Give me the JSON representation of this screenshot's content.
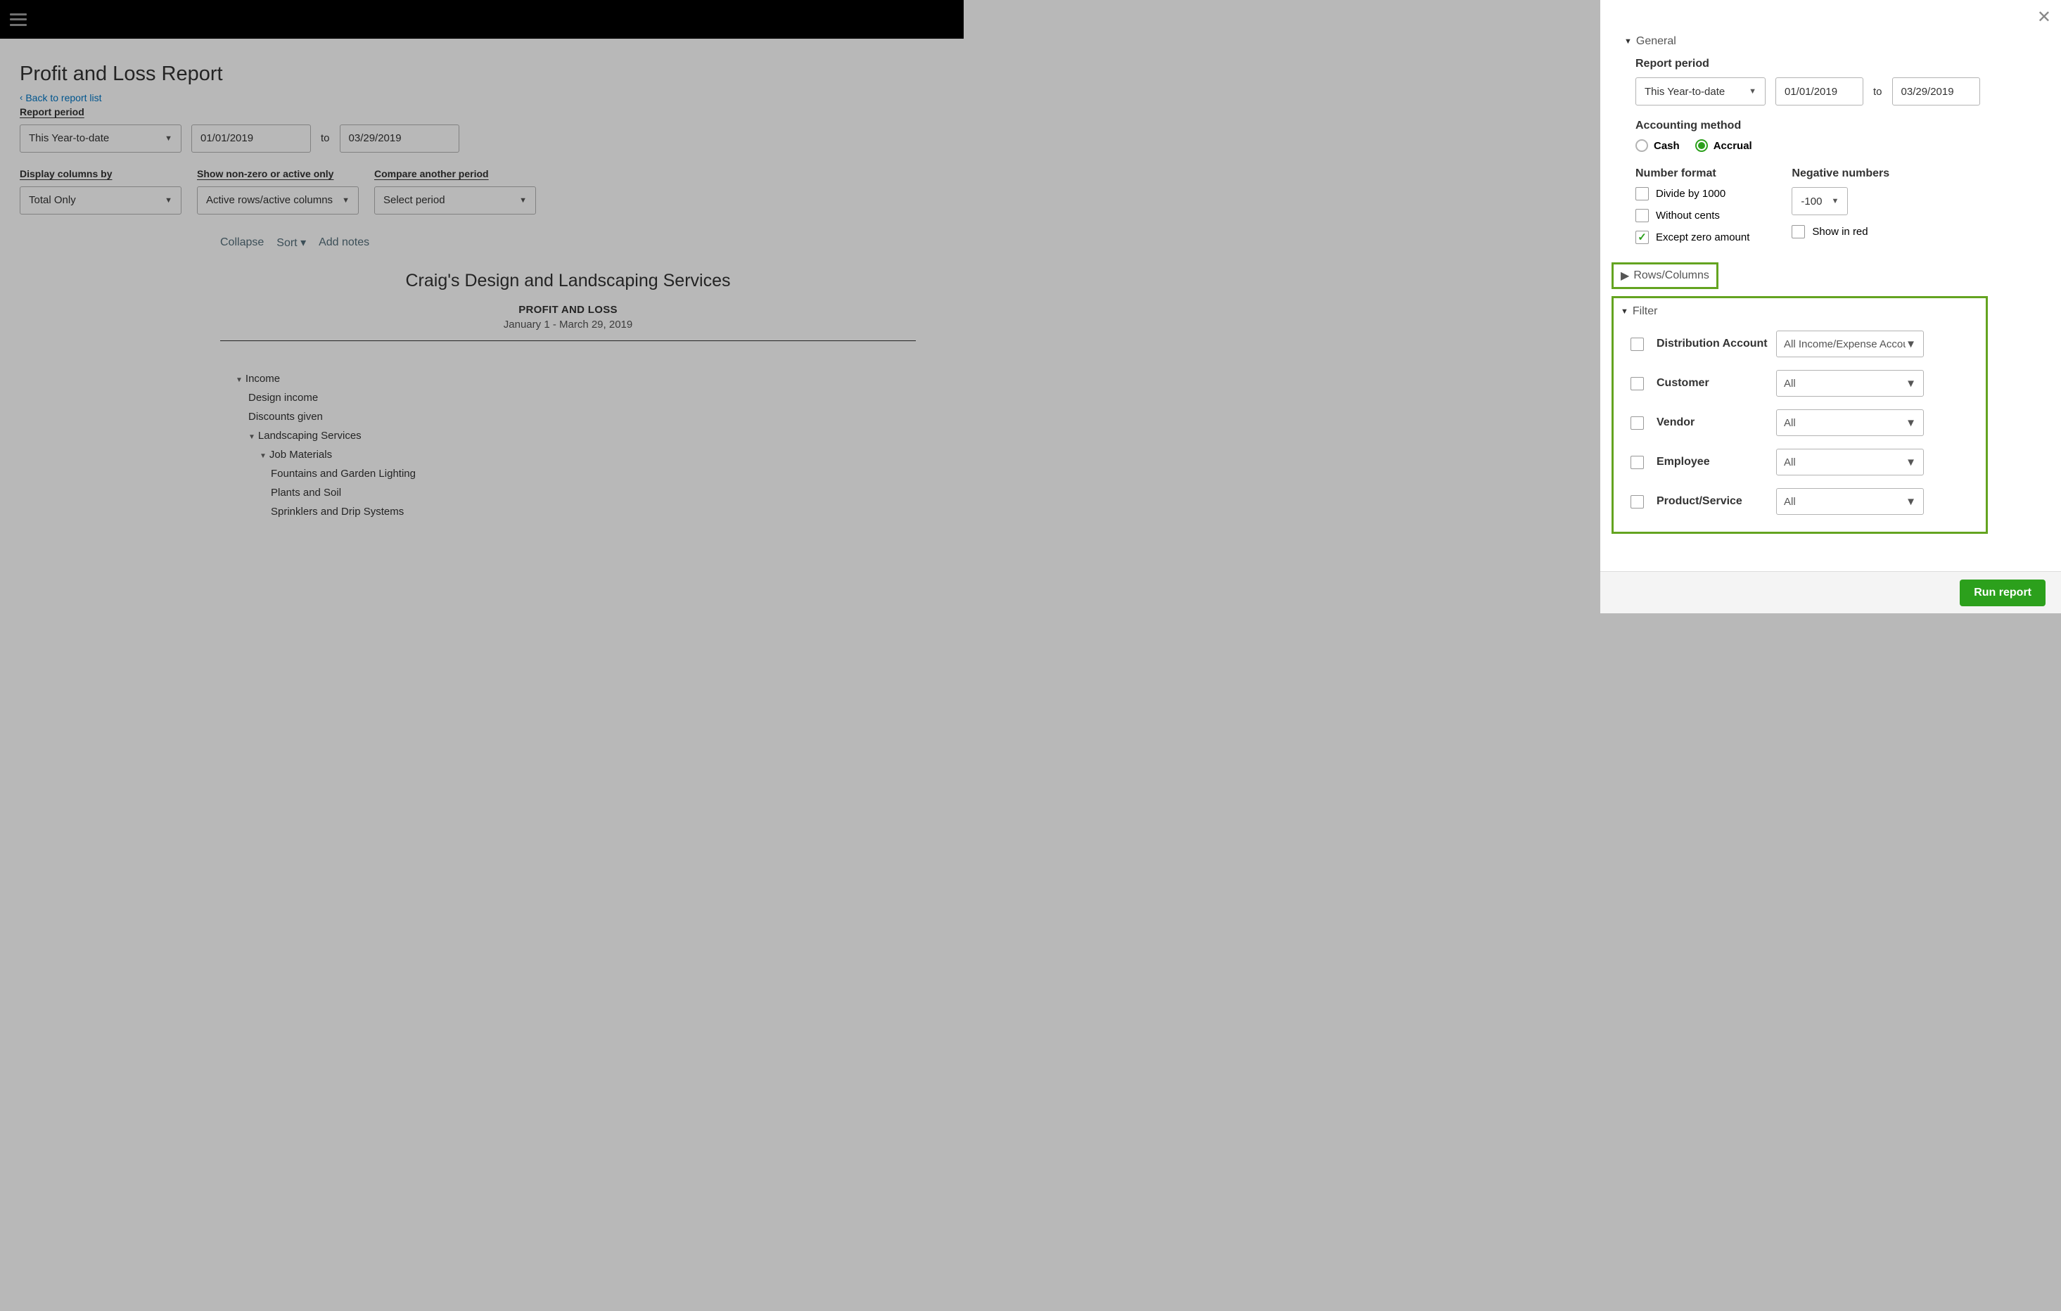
{
  "page": {
    "title": "Profit and Loss Report",
    "back_link": "Back to report list",
    "report_period_label": "Report period",
    "period_select": "This Year-to-date",
    "date_from": "01/01/2019",
    "to": "to",
    "date_to": "03/29/2019",
    "display_columns_label": "Display columns by",
    "display_columns_value": "Total Only",
    "show_nonzero_label": "Show non-zero or active only",
    "show_nonzero_value": "Active rows/active columns",
    "compare_label": "Compare another period",
    "compare_value": "Select period"
  },
  "report": {
    "toolbar": {
      "collapse": "Collapse",
      "sort": "Sort",
      "addnotes": "Add notes"
    },
    "company": "Craig's Design and Landscaping Services",
    "name": "PROFIT AND LOSS",
    "range": "January 1 - March 29, 2019",
    "rows": [
      {
        "label": "Income",
        "indent": 1,
        "arrow": true
      },
      {
        "label": "Design income",
        "indent": 2
      },
      {
        "label": "Discounts given",
        "indent": 2
      },
      {
        "label": "Landscaping Services",
        "indent": 2,
        "arrow": true
      },
      {
        "label": "Job Materials",
        "indent": 3,
        "arrow": true
      },
      {
        "label": "Fountains and Garden Lighting",
        "indent": 4
      },
      {
        "label": "Plants and Soil",
        "indent": 4
      },
      {
        "label": "Sprinklers and Drip Systems",
        "indent": 4
      }
    ]
  },
  "panel": {
    "general": "General",
    "report_period_label": "Report period",
    "period_select": "This Year-to-date",
    "date_from": "01/01/2019",
    "to": "to",
    "date_to": "03/29/2019",
    "accounting_method": "Accounting method",
    "cash": "Cash",
    "accrual": "Accrual",
    "number_format": "Number format",
    "divide_by_1000": "Divide by 1000",
    "without_cents": "Without cents",
    "except_zero": "Except zero amount",
    "negative_numbers": "Negative numbers",
    "neg_select": "-100",
    "show_in_red": "Show in red",
    "rows_columns": "Rows/Columns",
    "filter": "Filter",
    "filters": [
      {
        "label": "Distribution Account",
        "value": "All Income/Expense Accounts"
      },
      {
        "label": "Customer",
        "value": "All"
      },
      {
        "label": "Vendor",
        "value": "All"
      },
      {
        "label": "Employee",
        "value": "All"
      },
      {
        "label": "Product/Service",
        "value": "All"
      }
    ],
    "run": "Run report"
  }
}
